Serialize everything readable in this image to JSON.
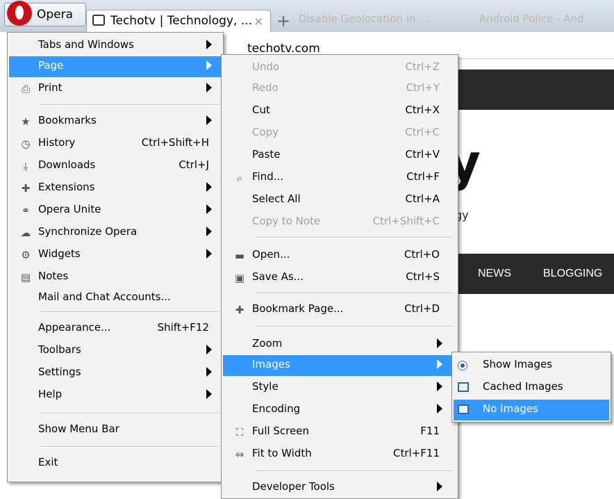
{
  "browser": {
    "opera_button_label": "Opera",
    "active_tab_title": "Techotv | Technology, ...",
    "tab_close": "×",
    "faded_tab_1": "Disable Geolocation in ...",
    "faded_tab_2": "Android Police - And",
    "address": "techotv.com"
  },
  "page": {
    "big_char": "y",
    "small_char": "gy",
    "nav_items": [
      "NEWS",
      "BLOGGING"
    ]
  },
  "main_menu": {
    "items": [
      {
        "label": "Tabs and Windows",
        "shortcut": "",
        "submenu": true
      },
      {
        "label": "Page",
        "shortcut": "",
        "submenu": true,
        "highlighted": true
      },
      {
        "label": "Print",
        "shortcut": "",
        "submenu": true,
        "icon": "printer-icon"
      },
      {
        "label": "Bookmarks",
        "shortcut": "",
        "submenu": true,
        "icon": "star-icon"
      },
      {
        "label": "History",
        "shortcut": "Ctrl+Shift+H",
        "icon": "history-icon"
      },
      {
        "label": "Downloads",
        "shortcut": "Ctrl+J",
        "icon": "downloads-icon"
      },
      {
        "label": "Extensions",
        "shortcut": "",
        "submenu": true,
        "icon": "puzzle-icon"
      },
      {
        "label": "Opera Unite",
        "shortcut": "",
        "submenu": true,
        "icon": "unite-icon"
      },
      {
        "label": "Synchronize Opera",
        "shortcut": "",
        "submenu": true,
        "icon": "cloud-icon"
      },
      {
        "label": "Widgets",
        "shortcut": "",
        "submenu": true,
        "icon": "gear-icon"
      },
      {
        "label": "Notes",
        "shortcut": "",
        "icon": "notes-icon"
      },
      {
        "label": "Mail and Chat Accounts...",
        "shortcut": ""
      },
      {
        "label": "Appearance...",
        "shortcut": "Shift+F12"
      },
      {
        "label": "Toolbars",
        "shortcut": "",
        "submenu": true
      },
      {
        "label": "Settings",
        "shortcut": "",
        "submenu": true
      },
      {
        "label": "Help",
        "shortcut": "",
        "submenu": true
      },
      {
        "label": "Show Menu Bar",
        "shortcut": ""
      },
      {
        "label": "Exit",
        "shortcut": ""
      }
    ]
  },
  "page_menu": {
    "items": [
      {
        "label": "Undo",
        "shortcut": "Ctrl+Z",
        "disabled": true
      },
      {
        "label": "Redo",
        "shortcut": "Ctrl+Y",
        "disabled": true
      },
      {
        "label": "Cut",
        "shortcut": "Ctrl+X"
      },
      {
        "label": "Copy",
        "shortcut": "Ctrl+C",
        "disabled": true
      },
      {
        "label": "Paste",
        "shortcut": "Ctrl+V"
      },
      {
        "label": "Find...",
        "shortcut": "Ctrl+F",
        "icon": "search-icon"
      },
      {
        "label": "Select All",
        "shortcut": "Ctrl+A"
      },
      {
        "label": "Copy to Note",
        "shortcut": "Ctrl+Shift+C",
        "disabled": true
      },
      {
        "label": "Open...",
        "shortcut": "Ctrl+O",
        "icon": "folder-icon"
      },
      {
        "label": "Save As...",
        "shortcut": "Ctrl+S",
        "icon": "save-icon"
      },
      {
        "label": "Bookmark Page...",
        "shortcut": "Ctrl+D",
        "icon": "plus-icon"
      },
      {
        "label": "Zoom",
        "shortcut": "",
        "submenu": true
      },
      {
        "label": "Images",
        "shortcut": "",
        "submenu": true,
        "highlighted": true
      },
      {
        "label": "Style",
        "shortcut": "",
        "submenu": true
      },
      {
        "label": "Encoding",
        "shortcut": "",
        "submenu": true
      },
      {
        "label": "Full Screen",
        "shortcut": "F11",
        "icon": "fullscreen-icon"
      },
      {
        "label": "Fit to Width",
        "shortcut": "Ctrl+F11",
        "icon": "fit-width-icon"
      },
      {
        "label": "Developer Tools",
        "shortcut": "",
        "submenu": true
      }
    ]
  },
  "images_menu": {
    "items": [
      {
        "label": "Show Images",
        "icon": "radio-selected-icon"
      },
      {
        "label": "Cached Images",
        "icon": "cached-images-icon"
      },
      {
        "label": "No Images",
        "icon": "no-images-icon",
        "highlighted": true
      }
    ]
  },
  "colors": {
    "highlight": "#3399ff",
    "menu_bg": "#f2f2f2",
    "dark_bar": "#2b2b2b",
    "opera_red": "#c8101a"
  }
}
